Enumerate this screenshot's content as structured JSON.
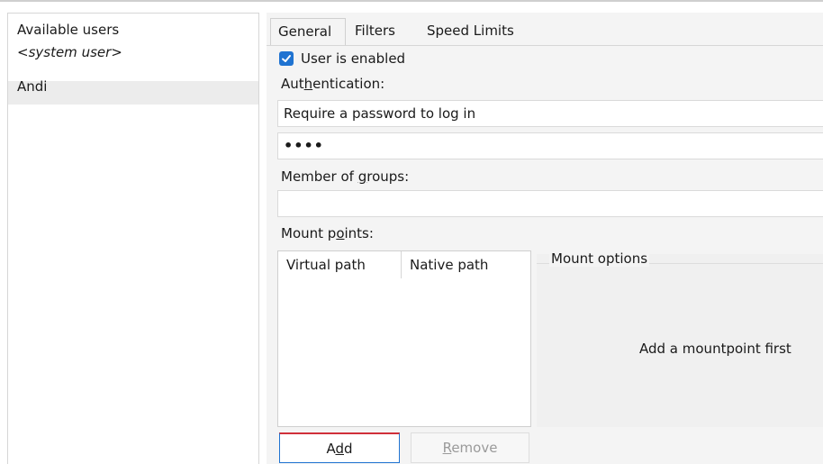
{
  "users": {
    "header": "Available users",
    "items": [
      {
        "label": "<system user>"
      },
      {
        "label": "Andi"
      }
    ]
  },
  "tabs": [
    {
      "label": "General"
    },
    {
      "label": "Filters"
    },
    {
      "label": "Speed Limits"
    }
  ],
  "general": {
    "user_enabled_label": "User is enabled",
    "user_enabled_checked": true,
    "authentication_label_pre": "Aut",
    "authentication_label_mnemonic": "h",
    "authentication_label_post": "entication:",
    "authentication_value": "Require a password to log in",
    "password_value": "••••",
    "groups_label_pre": "Member of ",
    "groups_label_mnemonic": "g",
    "groups_label_post": "roups:",
    "groups_value": "",
    "mount_label_pre": "Mount p",
    "mount_label_mnemonic": "o",
    "mount_label_post": "ints:",
    "mount_columns": [
      "Virtual path",
      "Native path"
    ],
    "mount_options_title": "Mount options",
    "mount_options_message": "Add a mountpoint first",
    "add_pre": "A",
    "add_mnemonic": "d",
    "add_post": "d",
    "remove_pre": "",
    "remove_mnemonic": "R",
    "remove_post": "emove"
  },
  "colors": {
    "accent": "#1f73d1",
    "selection": "#ececec",
    "focus_line": "#d0303a"
  },
  "icons": {
    "checkbox": "check-icon"
  }
}
